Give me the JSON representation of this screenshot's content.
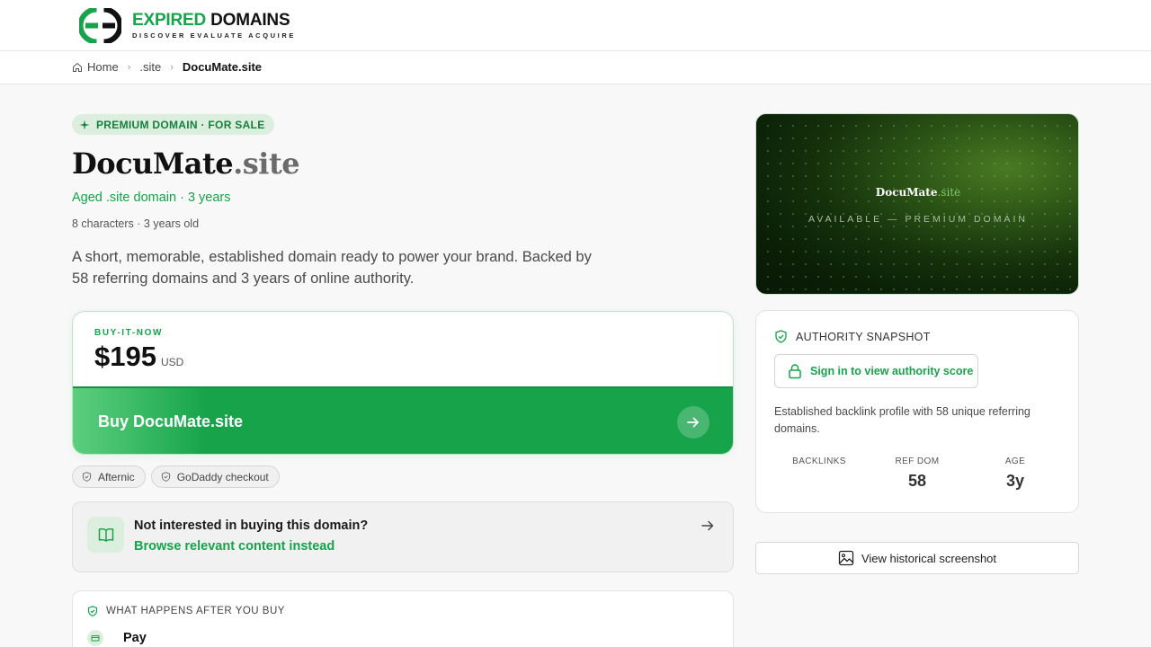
{
  "brand": {
    "name_part1": "EXPIRED",
    "name_part2": "DOMAINS",
    "tagline": "DISCOVER EVALUATE ACQUIRE",
    "accent": "#16a34a"
  },
  "breadcrumb": {
    "home": "Home",
    "tld": ".site",
    "current": "DocuMate.site"
  },
  "listing": {
    "badge": "PREMIUM DOMAIN · FOR SALE",
    "name": "DocuMate",
    "tld": ".site",
    "aged_line": "Aged .site domain · 3 years",
    "meta_line": "8 characters · 3 years old",
    "description": "A short, memorable, established domain ready to power your brand. Backed by 58 referring domains and 3 years of online authority."
  },
  "buy": {
    "label": "BUY-IT-NOW",
    "price": "$195",
    "currency": "USD",
    "button_label": "Buy DocuMate.site"
  },
  "chips": [
    "Afternic",
    "GoDaddy checkout"
  ],
  "alternative": {
    "question": "Not interested in buying this domain?",
    "link": "Browse relevant content instead"
  },
  "after_buy": {
    "heading": "WHAT HAPPENS AFTER YOU BUY",
    "steps": [
      "Pay"
    ]
  },
  "hero": {
    "name": "DocuMate",
    "tld": ".site",
    "subtitle": "AVAILABLE — PREMIUM DOMAIN"
  },
  "authority": {
    "heading": "AUTHORITY SNAPSHOT",
    "signin_label": "Sign in to view authority score",
    "description": "Established backlink profile with 58 unique referring domains.",
    "stats": [
      {
        "label": "BACKLINKS",
        "value": ""
      },
      {
        "label": "REF DOM",
        "value": "58"
      },
      {
        "label": "AGE",
        "value": "3y"
      }
    ]
  },
  "history_button": "View historical screenshot"
}
